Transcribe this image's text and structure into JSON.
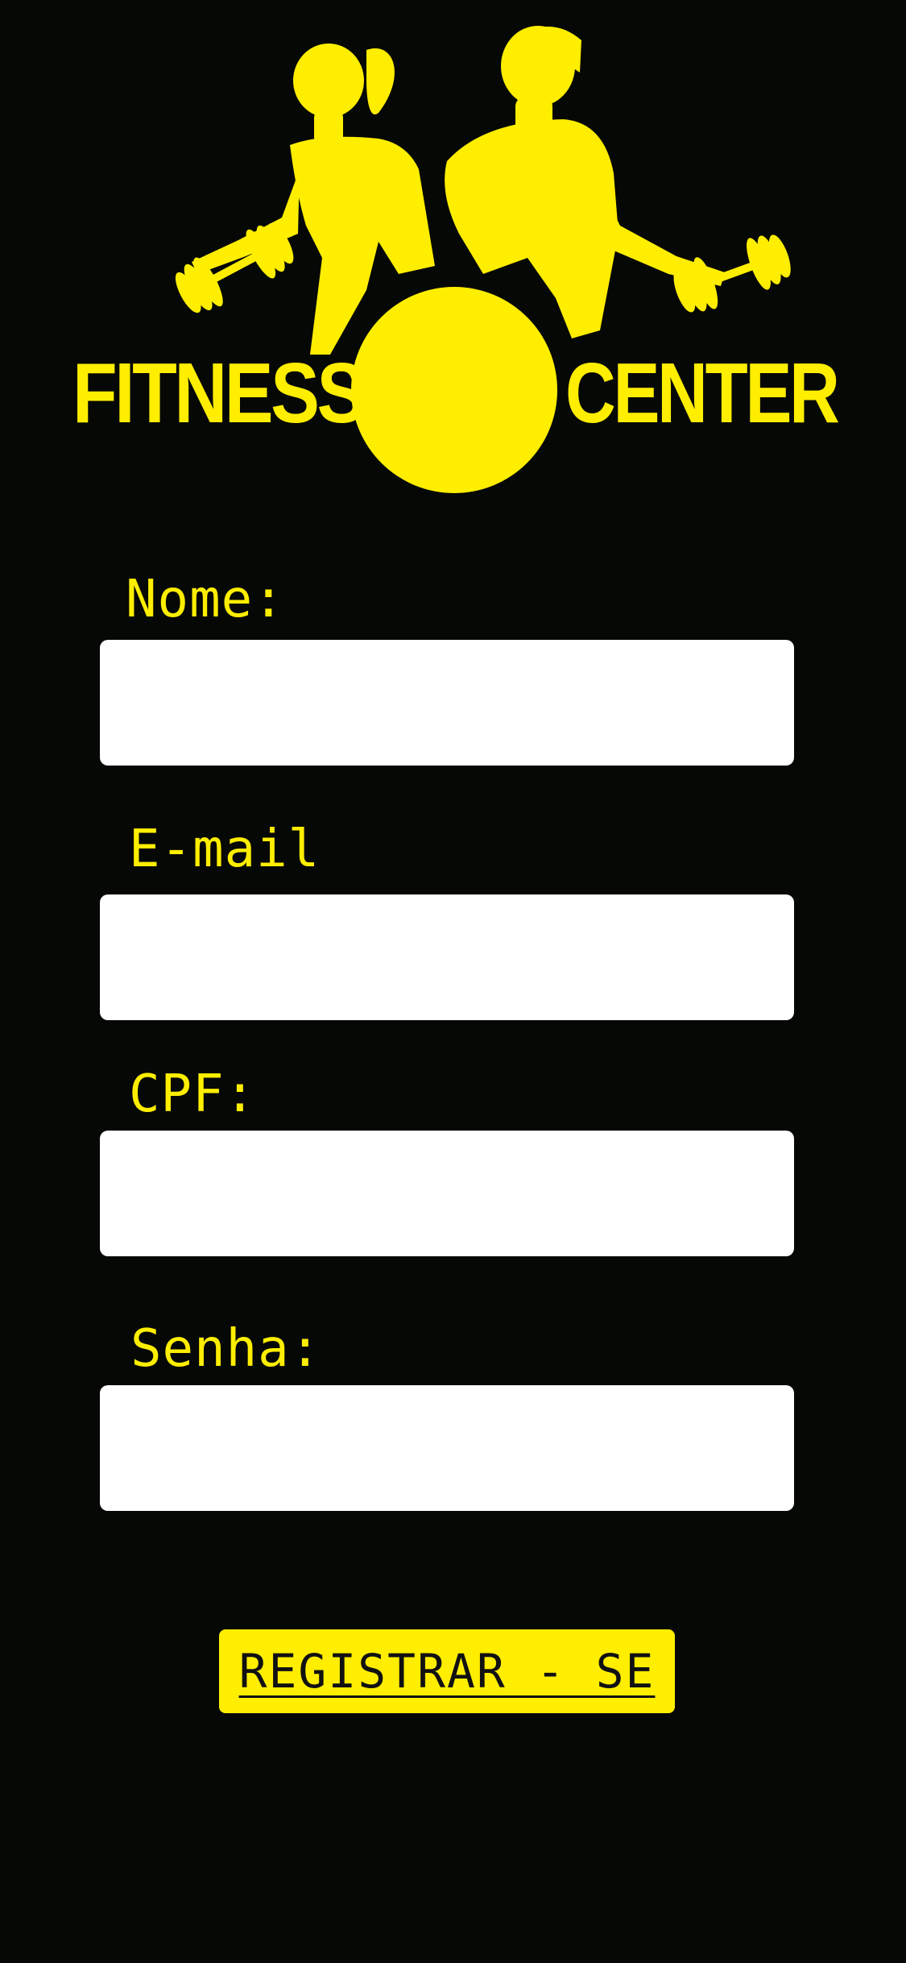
{
  "brand": {
    "word_left": "FITNESS",
    "word_right": "CENTER",
    "color": "#ffee00",
    "logo_icon": "fitness-athletes-logo"
  },
  "form": {
    "name_label": "Nome:",
    "name_value": "",
    "email_label": "E-mail",
    "email_value": "",
    "cpf_label": "CPF:",
    "cpf_value": "",
    "password_label": "Senha:",
    "password_value": "",
    "submit_label": "REGISTRAR - SE"
  },
  "colors": {
    "background": "#060805",
    "accent": "#ffee00",
    "input_background": "#ffffff"
  }
}
